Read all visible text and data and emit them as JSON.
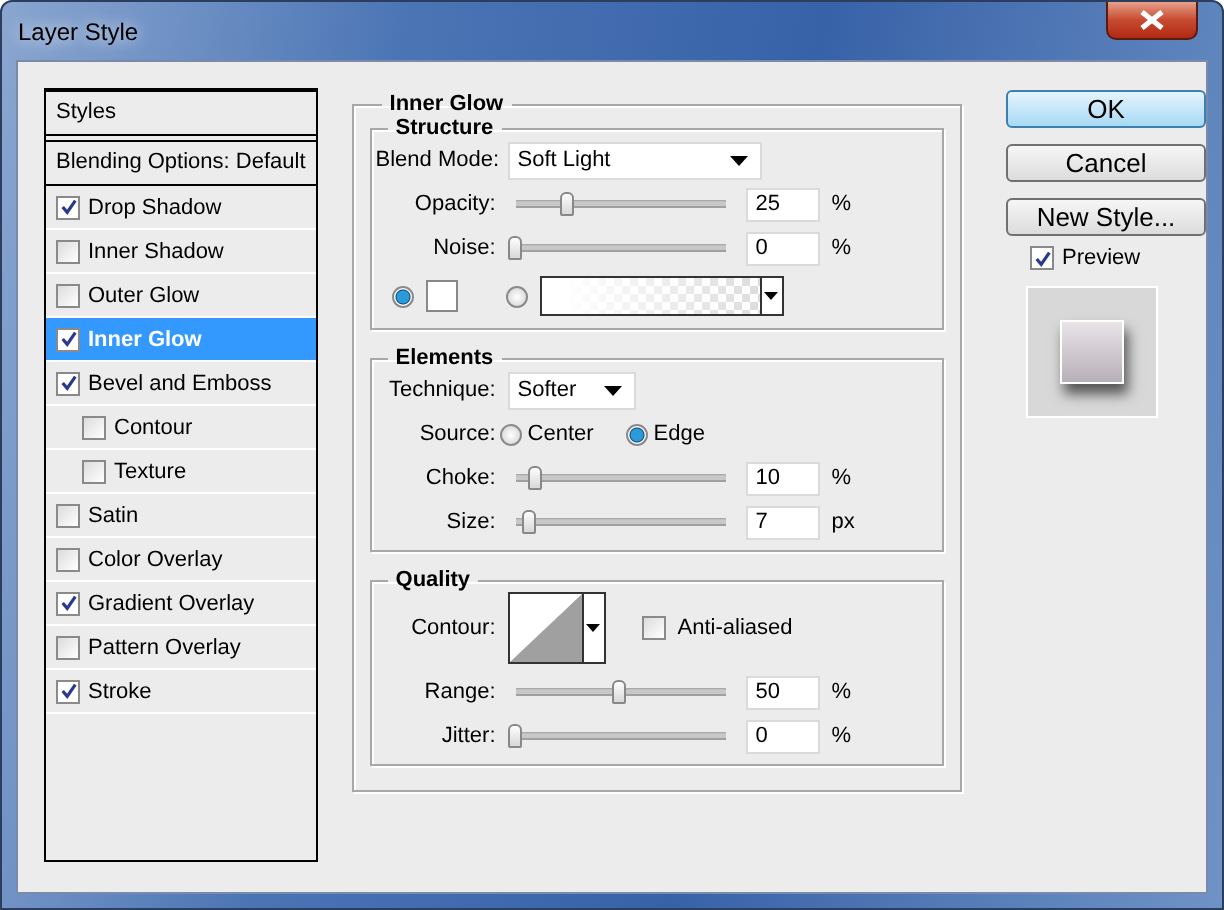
{
  "window": {
    "title": "Layer Style"
  },
  "styles_list": {
    "header": "Styles",
    "blending": "Blending Options: Default",
    "items": [
      {
        "label": "Drop Shadow",
        "checked": true,
        "selected": false
      },
      {
        "label": "Inner Shadow",
        "checked": false,
        "selected": false
      },
      {
        "label": "Outer Glow",
        "checked": false,
        "selected": false
      },
      {
        "label": "Inner Glow",
        "checked": true,
        "selected": true
      },
      {
        "label": "Bevel and Emboss",
        "checked": true,
        "selected": false,
        "children": [
          {
            "label": "Contour",
            "checked": false,
            "selected": false
          },
          {
            "label": "Texture",
            "checked": false,
            "selected": false
          }
        ]
      },
      {
        "label": "Satin",
        "checked": false,
        "selected": false
      },
      {
        "label": "Color Overlay",
        "checked": false,
        "selected": false
      },
      {
        "label": "Gradient Overlay",
        "checked": true,
        "selected": false
      },
      {
        "label": "Pattern Overlay",
        "checked": false,
        "selected": false
      },
      {
        "label": "Stroke",
        "checked": true,
        "selected": false
      }
    ]
  },
  "panel": {
    "title": "Inner Glow",
    "sections": [
      {
        "title": "Structure",
        "rows": [
          {
            "kind": "dropdown",
            "label": "Blend Mode:",
            "value": "Soft Light",
            "wide": true
          },
          {
            "kind": "slider",
            "label": "Opacity:",
            "level": 0.25,
            "value": "25",
            "unit": "%"
          },
          {
            "kind": "slider",
            "label": "Noise:",
            "level": 0,
            "value": "0",
            "unit": "%"
          },
          {
            "kind": "fill",
            "options": [
              {
                "kind": "color",
                "selected": true
              },
              {
                "kind": "gradient",
                "selected": false
              }
            ]
          }
        ]
      },
      {
        "title": "Elements",
        "rows": [
          {
            "kind": "dropdown",
            "label": "Technique:",
            "value": "Softer",
            "wide": false
          },
          {
            "kind": "radio",
            "label": "Source:",
            "options": [
              {
                "label": "Center",
                "selected": false
              },
              {
                "label": "Edge",
                "selected": true
              }
            ]
          },
          {
            "kind": "slider",
            "label": "Choke:",
            "level": 0.1,
            "value": "10",
            "unit": "%"
          },
          {
            "kind": "slider",
            "label": "Size:",
            "level": 0.07,
            "value": "7",
            "unit": "px"
          }
        ]
      },
      {
        "title": "Quality",
        "rows": [
          {
            "kind": "contour",
            "label": "Contour:",
            "checkbox": {
              "label": "Anti-aliased",
              "checked": false
            }
          },
          {
            "kind": "slider",
            "label": "Range:",
            "level": 0.5,
            "value": "50",
            "unit": "%"
          },
          {
            "kind": "slider",
            "label": "Jitter:",
            "level": 0,
            "value": "0",
            "unit": "%"
          }
        ]
      }
    ]
  },
  "buttons": [
    {
      "label": "OK",
      "default": true
    },
    {
      "label": "Cancel",
      "default": false
    },
    {
      "label": "New Style...",
      "default": false
    }
  ],
  "preview": {
    "label": "Preview",
    "checked": true
  }
}
